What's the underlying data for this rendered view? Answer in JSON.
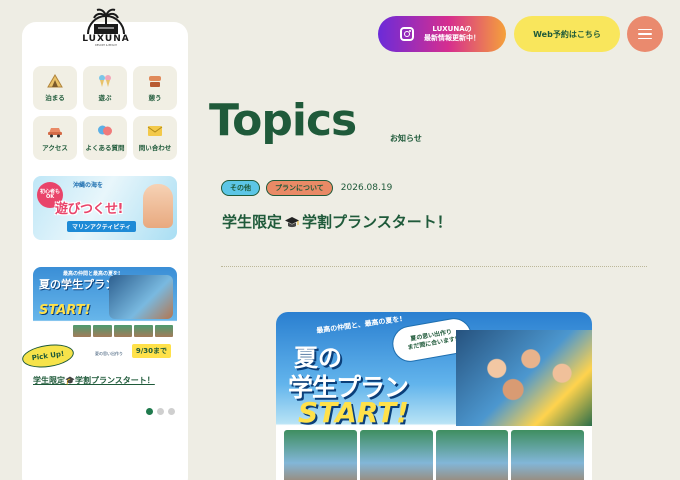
{
  "logo": {
    "text": "LUXUNA",
    "sub": "RESORT & BEACH"
  },
  "header": {
    "instagram_label_line1": "LUXUNAの",
    "instagram_label_line2": "最新情報更新中！",
    "web_reserve_label": "Web予約はこちら",
    "menu_icon": "hamburger-icon"
  },
  "sidebar": {
    "nav": [
      {
        "label": "泊まる",
        "icon": "tent-icon"
      },
      {
        "label": "遊ぶ",
        "icon": "ice-cream-icon"
      },
      {
        "label": "憩う",
        "icon": "cafe-icon"
      },
      {
        "label": "アクセス",
        "icon": "car-icon"
      },
      {
        "label": "よくある質問",
        "icon": "speech-bubble-icon"
      },
      {
        "label": "問い合わせ",
        "icon": "mail-icon"
      }
    ],
    "banner1": {
      "badge": "初心者もOK",
      "title": "遊びつくせ!",
      "top": "沖縄の海を",
      "tag": "マリンアクティビティ"
    },
    "banner2": {
      "top": "最高の仲間と最高の夏を!",
      "headline": "夏の学生プラン",
      "start": "START!",
      "note": "夏の思い出作り",
      "date": "9/30まで"
    },
    "pickup_label": "Pick Up!",
    "caption": "学生限定🎓学割プランスタート！",
    "carousel": {
      "count": 3,
      "active": 0
    }
  },
  "main": {
    "title": "Topics",
    "subtitle": "お知らせ",
    "tags": [
      "その他",
      "プランについて"
    ],
    "date": "2026.08.19",
    "post_title_before": "学生限定",
    "post_title_after": "学割プランスタート！",
    "hero": {
      "top": "最高の仲間と、最高の夏を!",
      "bubble": "夏の思い出作り\nまだ間に合います!",
      "natsu": "夏の",
      "plan": "学生プラン",
      "start": "START!"
    }
  },
  "colors": {
    "background": "#eeede4",
    "brand_green": "#1f5a3a",
    "yellow": "#f9e65c",
    "coral": "#ea8a6e",
    "tag_blue": "#5cc6e6",
    "tag_orange": "#e98a66"
  }
}
